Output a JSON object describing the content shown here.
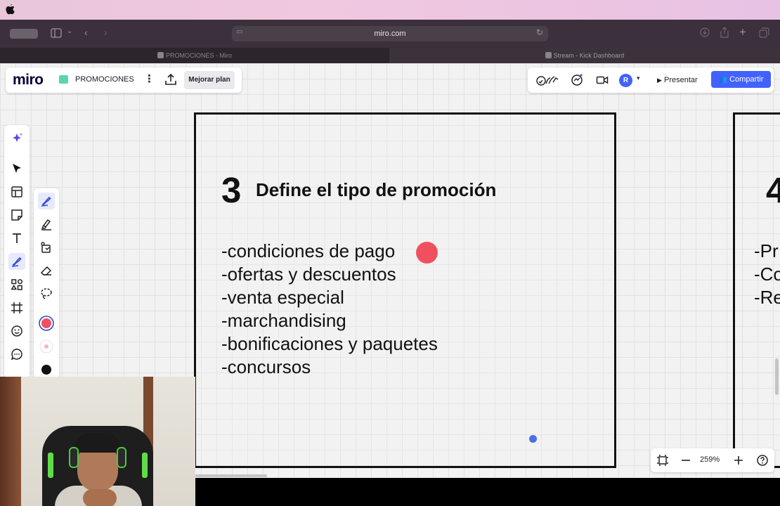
{
  "browser": {
    "url": "miro.com",
    "tabs": [
      {
        "label": "PROMOCIONES - Miro",
        "active": false
      },
      {
        "label": "Stream - Kick Dashboard",
        "active": true
      }
    ]
  },
  "miro": {
    "logo": "miro",
    "board_name": "PROMOCIONES",
    "upgrade_label": "Mejorar plan",
    "avatar_initial": "R",
    "present_label": "Presentar",
    "share_label": "Compartir",
    "zoom": "259%"
  },
  "frame3": {
    "number": "3",
    "title": "Define el tipo de promoción",
    "items": [
      "-condiciones de pago",
      "-ofertas y descuentos",
      "-venta especial",
      "-marchandising",
      "-bonificaciones y paquetes",
      "-concursos"
    ]
  },
  "frame4": {
    "number": "4",
    "items": [
      "-Pr",
      "-Co",
      "-Re"
    ]
  },
  "colors": {
    "accent": "#4262ff",
    "red_marker": "#f0505e",
    "board_icon": "#5cd4b0"
  }
}
